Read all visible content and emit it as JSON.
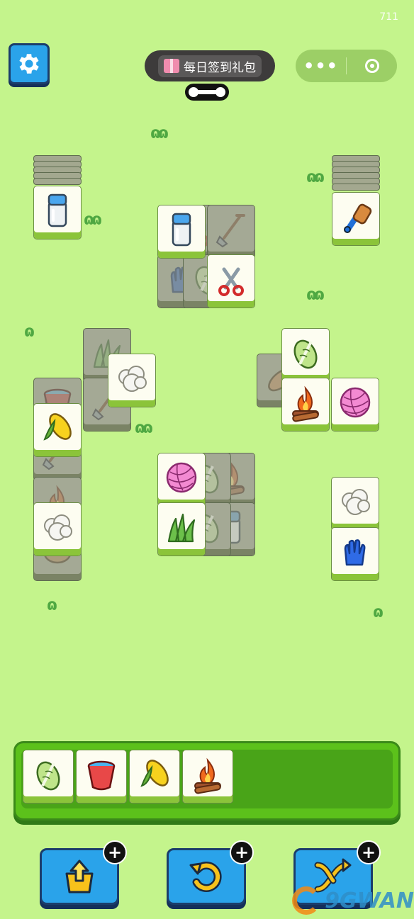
{
  "status_bar": {
    "number": "711"
  },
  "top_bar": {
    "settings_icon": "gear-icon",
    "daily_gift_label": "每日签到礼包",
    "daily_gift_icon": "gift-icon",
    "menu_icon": "more-dots-icon",
    "close_icon": "target-icon"
  },
  "board": {
    "tiles": [
      {
        "item": "milk-bottle",
        "state": "free"
      },
      {
        "item": "brush",
        "state": "free"
      },
      {
        "item": "milk-bottle",
        "state": "free"
      },
      {
        "item": "shears",
        "state": "covered"
      },
      {
        "item": "shovel",
        "state": "covered"
      },
      {
        "item": "glove",
        "state": "covered"
      },
      {
        "item": "cabbage",
        "state": "covered"
      },
      {
        "item": "scissors",
        "state": "free"
      },
      {
        "item": "grass",
        "state": "covered"
      },
      {
        "item": "cotton",
        "state": "free"
      },
      {
        "item": "bucket",
        "state": "covered"
      },
      {
        "item": "shovel",
        "state": "covered"
      },
      {
        "item": "corn",
        "state": "free"
      },
      {
        "item": "shovel",
        "state": "covered"
      },
      {
        "item": "campfire",
        "state": "covered"
      },
      {
        "item": "cotton",
        "state": "free"
      },
      {
        "item": "potato",
        "state": "covered"
      },
      {
        "item": "cabbage",
        "state": "free"
      },
      {
        "item": "sweet-potato",
        "state": "covered"
      },
      {
        "item": "campfire",
        "state": "free"
      },
      {
        "item": "yarn",
        "state": "free"
      },
      {
        "item": "yarn",
        "state": "free"
      },
      {
        "item": "campfire",
        "state": "covered"
      },
      {
        "item": "cabbage",
        "state": "covered"
      },
      {
        "item": "grass",
        "state": "free"
      },
      {
        "item": "milk-bottle",
        "state": "covered"
      },
      {
        "item": "cabbage",
        "state": "covered"
      },
      {
        "item": "cotton",
        "state": "free"
      },
      {
        "item": "glove",
        "state": "free"
      }
    ]
  },
  "tray": {
    "slots": [
      "cabbage",
      "bucket",
      "corn",
      "campfire"
    ]
  },
  "tools": [
    {
      "name": "move-out",
      "icon": "pop-out-icon",
      "badge": "+"
    },
    {
      "name": "undo",
      "icon": "undo-icon",
      "badge": "+"
    },
    {
      "name": "shuffle",
      "icon": "shuffle-icon",
      "badge": "+"
    }
  ],
  "watermark": {
    "text": "9GWAN"
  }
}
